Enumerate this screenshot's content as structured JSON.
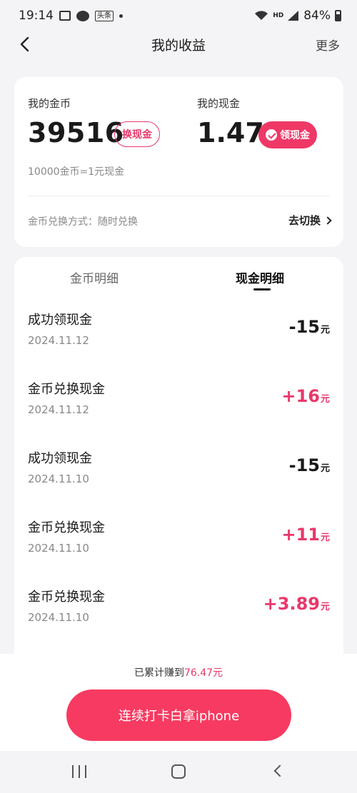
{
  "status_bar": {
    "time": "19:14",
    "news_icon_text": "头条",
    "network": "HD",
    "battery": "84%",
    "icons": [
      "gallery-icon",
      "chat-icon",
      "news-icon",
      "wifi-icon",
      "signal-icon",
      "battery-icon"
    ]
  },
  "header": {
    "title": "我的收益",
    "more": "更多"
  },
  "summary": {
    "coins_label": "我的金币",
    "coins_value": "39516",
    "exchange_button": "换现金",
    "cash_label": "我的现金",
    "cash_value": "1.47",
    "withdraw_button": "领现金",
    "rate": "10000金币=1元现金",
    "exchange_mode": "金币兑换方式：随时兑换",
    "switch_link": "去切换"
  },
  "tabs": {
    "coins": "金币明细",
    "cash": "现金明细",
    "active": "cash"
  },
  "transactions": [
    {
      "title": "成功领现金",
      "date": "2024.11.12",
      "amount": "-15",
      "unit": "元"
    },
    {
      "title": "金币兑换现金",
      "date": "2024.11.12",
      "amount": "+16",
      "unit": "元"
    },
    {
      "title": "成功领现金",
      "date": "2024.11.10",
      "amount": "-15",
      "unit": "元"
    },
    {
      "title": "金币兑换现金",
      "date": "2024.11.10",
      "amount": "+11",
      "unit": "元"
    },
    {
      "title": "金币兑换现金",
      "date": "2024.11.10",
      "amount": "+3.89",
      "unit": "元"
    }
  ],
  "footer": {
    "earned_prefix": "已累计赚到",
    "earned_amount": "76.47元",
    "checkin_button": "连续打卡白拿iphone"
  },
  "colors": {
    "accent": "#ef3866",
    "background": "#f4f4f6"
  }
}
